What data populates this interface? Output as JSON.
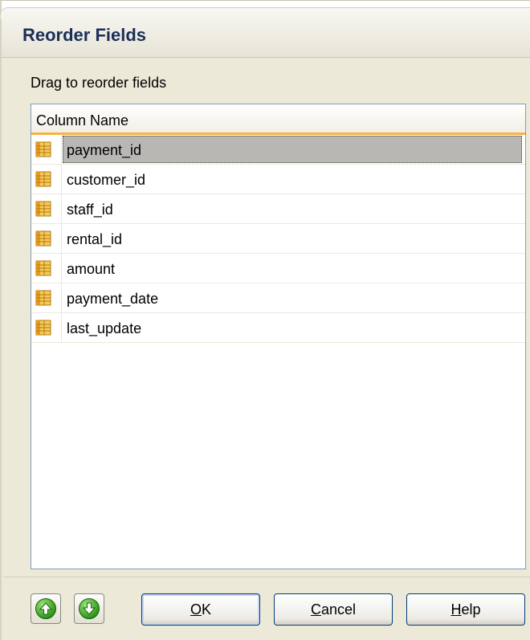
{
  "window": {
    "title": "Reorder Fields"
  },
  "hint": "Drag to reorder fields",
  "list": {
    "column_header": "Column Name",
    "rows": [
      {
        "label": "payment_id",
        "selected": true
      },
      {
        "label": "customer_id",
        "selected": false
      },
      {
        "label": "staff_id",
        "selected": false
      },
      {
        "label": "rental_id",
        "selected": false
      },
      {
        "label": "amount",
        "selected": false
      },
      {
        "label": "payment_date",
        "selected": false
      },
      {
        "label": "last_update",
        "selected": false
      }
    ]
  },
  "buttons": {
    "move_up_icon": "arrow-up-icon",
    "move_down_icon": "arrow-down-icon",
    "ok": {
      "mnemonic": "O",
      "rest": "K"
    },
    "cancel": {
      "mnemonic": "C",
      "rest": "ancel"
    },
    "help": {
      "mnemonic": "H",
      "rest": "elp"
    }
  },
  "colors": {
    "accent_header_underline": "#f5b343",
    "selection": "#b8b7b3",
    "title_text": "#1b2f57"
  }
}
